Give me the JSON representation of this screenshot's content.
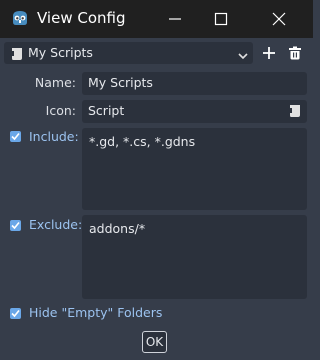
{
  "window": {
    "title": "View Config"
  },
  "scripts_selector": {
    "value": "My Scripts"
  },
  "form": {
    "name_label": "Name:",
    "name_value": "My Scripts",
    "icon_label": "Icon:",
    "icon_value": "Script",
    "include_label": "Include:",
    "include_value": "*.gd, *.cs, *.gdns",
    "exclude_label": "Exclude:",
    "exclude_value": "addons/*",
    "hide_empty_label": "Hide \"Empty\" Folders"
  },
  "buttons": {
    "ok_label": "OK"
  },
  "checks": {
    "include": true,
    "exclude": true,
    "hide_empty": true
  },
  "colors": {
    "accent": "#6aa7e8",
    "panel": "#363d4a",
    "field": "#2b313c",
    "titlebar": "#202020"
  },
  "icons": [
    "godot-app-icon",
    "script-icon",
    "chevron-down-icon",
    "plus-icon",
    "trash-icon",
    "minimize-icon",
    "maximize-icon",
    "close-icon",
    "checkmark-icon"
  ]
}
